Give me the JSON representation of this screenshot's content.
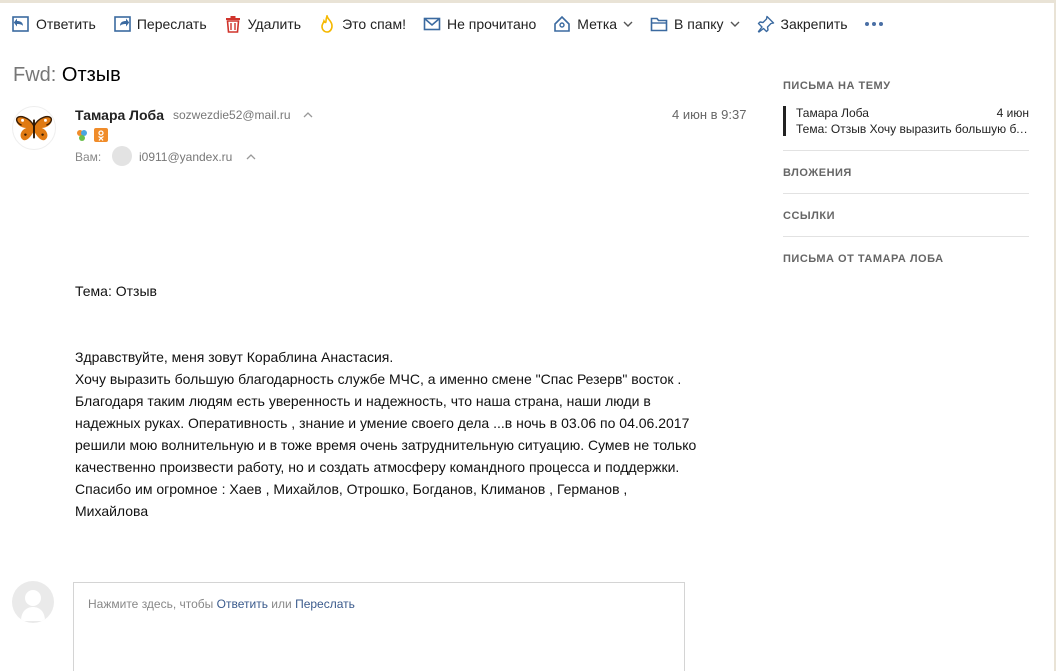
{
  "toolbar": {
    "reply": "Ответить",
    "forward": "Переслать",
    "delete": "Удалить",
    "spam": "Это спам!",
    "unread": "Не прочитано",
    "label": "Метка",
    "folder": "В папку",
    "pin": "Закрепить"
  },
  "message": {
    "subject_prefix": "Fwd:",
    "subject": "Отзыв",
    "sender_name": "Тамара Лоба",
    "sender_email": "sozwezdie52@mail.ru",
    "date": "4 июн в 9:37",
    "to_label": "Вам:",
    "to_email": "i0911@yandex.ru",
    "body_subject": "Тема: Отзыв",
    "body_lines": [
      "Здравствуйте, меня зовут Кораблина Анастасия.",
      "Хочу выразить большую благодарность службе МЧС, а именно смене \"Спас Резерв\" восток .",
      "Благодаря таким людям есть уверенность и надежность, что наша страна, наши люди в",
      "надежных руках.  Оперативность , знание и умение своего дела ...в ночь в 03.06 по 04.06.2017",
      "решили мою волнительную и  в тоже время очень затруднительную ситуацию. Сумев не только",
      "качественно произвести работу, но и создать атмосферу командного процесса и поддержки.",
      "Спасибо им огромное : Хаев , Михайлов, Отрошко, Богданов,  Климанов , Германов ,",
      "Михайлова"
    ]
  },
  "reply_box": {
    "prefix": "Нажмите здесь, чтобы",
    "reply_link": "Ответить",
    "or": "или",
    "forward_link": "Переслать"
  },
  "sidebar": {
    "thread_heading": "ПИСЬМА НА ТЕМУ",
    "thread_item": {
      "name": "Тамара Лоба",
      "date": "4 июн",
      "snippet": "Тема: Отзыв Хочу выразить большую благодарность"
    },
    "attachments": "ВЛОЖЕНИЯ",
    "links": "ССЫЛКИ",
    "from_sender": "ПИСЬМА ОТ ТАМАРА ЛОБА"
  },
  "colors": {
    "icon_blue": "#3b6aa0",
    "delete_red": "#d0342c",
    "spam_yellow": "#f5b800"
  }
}
